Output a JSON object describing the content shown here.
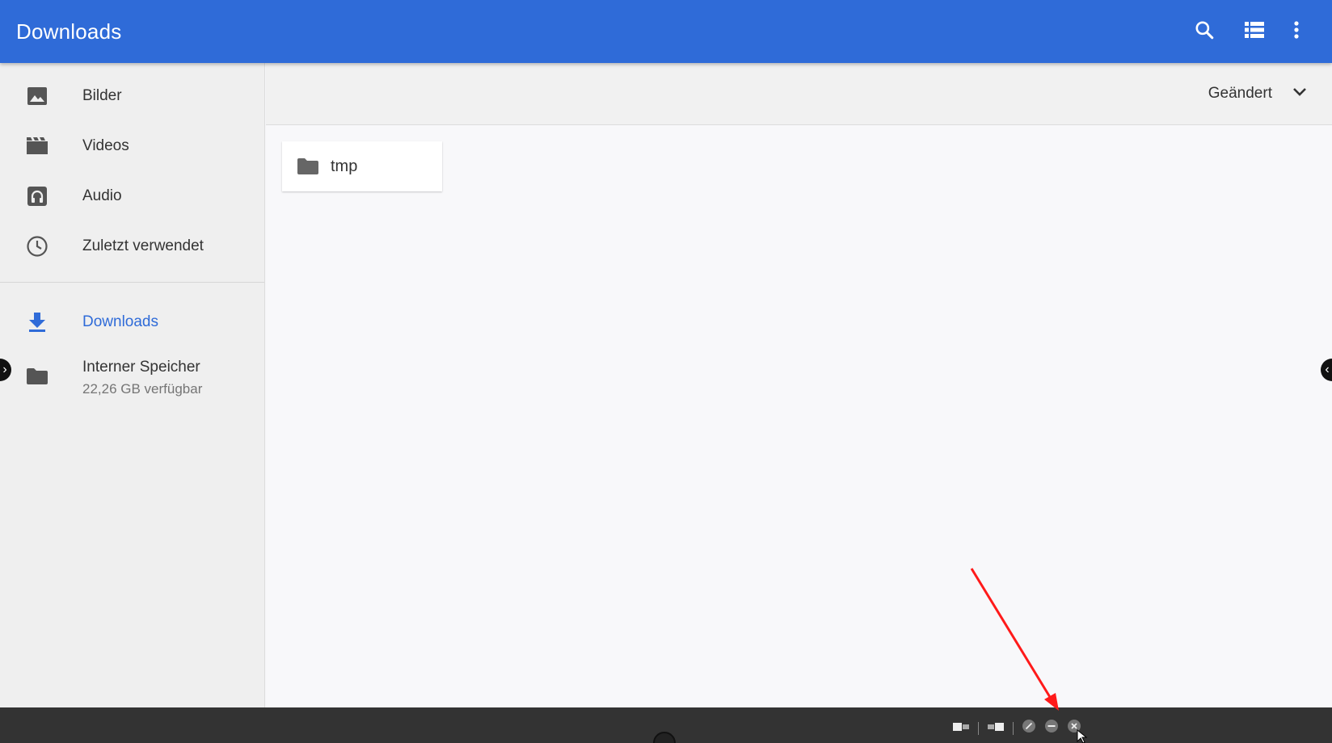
{
  "appbar": {
    "title": "Downloads",
    "actions": [
      "search-icon",
      "list-view-icon",
      "more-vert-icon"
    ]
  },
  "sidebar": {
    "items": [
      {
        "label": "Bilder",
        "icon": "image-icon"
      },
      {
        "label": "Videos",
        "icon": "video-icon"
      },
      {
        "label": "Audio",
        "icon": "audio-icon"
      },
      {
        "label": "Zuletzt verwendet",
        "icon": "clock-icon"
      }
    ],
    "volumes": [
      {
        "label": "Downloads",
        "icon": "download-icon",
        "active": true
      },
      {
        "label": "Interner Speicher",
        "sublabel": "22,26 GB verfügbar",
        "icon": "folder-icon"
      }
    ]
  },
  "main": {
    "sort_label": "Geändert",
    "files": [
      {
        "name": "tmp",
        "type": "folder"
      }
    ]
  },
  "colors": {
    "appbar": "#2f6bd8",
    "accent": "#2f6bd8",
    "annotation_arrow": "#ff0000",
    "shelf": "#333333"
  },
  "shelf": {
    "controls": [
      "snap-left-icon",
      "snap-right-icon",
      "fullscreen-icon",
      "minimize-icon",
      "close-icon"
    ]
  }
}
